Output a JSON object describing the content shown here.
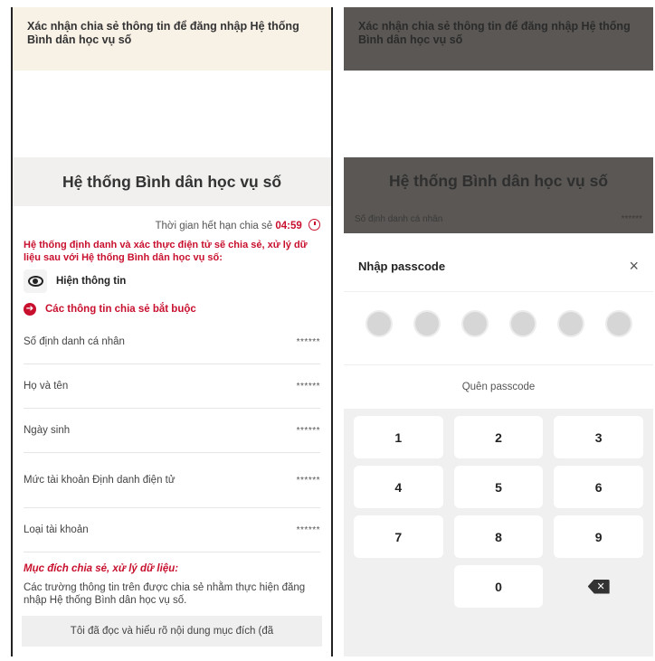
{
  "left": {
    "banner": "Xác nhận chia sẻ thông tin để đăng nhập Hệ thống Bình dân học vụ số",
    "title": "Hệ thống Bình dân học vụ số",
    "expire_label": "Thời gian hết hạn chia sẻ",
    "expire_time": "04:59",
    "intro": "Hệ thống định danh và xác thực điện tử sẽ chia sẻ, xử lý dữ liệu sau với Hệ thống Bình dân học vụ số:",
    "show_info": "Hiện thông tin",
    "required_label": "Các thông tin chia sẻ bắt buộc",
    "fields": [
      {
        "label": "Số định danh cá nhân",
        "value": "******"
      },
      {
        "label": "Họ và tên",
        "value": "******"
      },
      {
        "label": "Ngày sinh",
        "value": "******"
      },
      {
        "label": "Mức tài khoản Định danh điện tử",
        "value": "******"
      },
      {
        "label": "Loại tài khoản",
        "value": "******"
      }
    ],
    "purpose_title": "Mục đích chia sẻ, xử lý dữ liệu:",
    "purpose_text": "Các trường thông tin trên được chia sẻ nhằm thực hiện đăng nhập Hệ thống Bình dân học vụ số.",
    "ack_text": "Tôi đã đọc và hiểu rõ nội dung mục đích (đã"
  },
  "right": {
    "banner": "Xác nhận chia sẻ thông tin để đăng nhập Hệ thống Bình dân học vụ số",
    "title": "Hệ thống Bình dân học vụ số",
    "under_row_label": "Số định danh cá nhân",
    "under_row_value": "******",
    "sheet_title": "Nhập passcode",
    "close_glyph": "×",
    "passcode_length": 6,
    "forgot": "Quên passcode",
    "keys": [
      "1",
      "2",
      "3",
      "4",
      "5",
      "6",
      "7",
      "8",
      "9",
      "",
      "0",
      "⌫"
    ],
    "delete_glyph": "✕"
  },
  "colors": {
    "accent_red": "#c8102e",
    "overlay": "#5a5754",
    "banner_cream": "#f8f1e6"
  }
}
